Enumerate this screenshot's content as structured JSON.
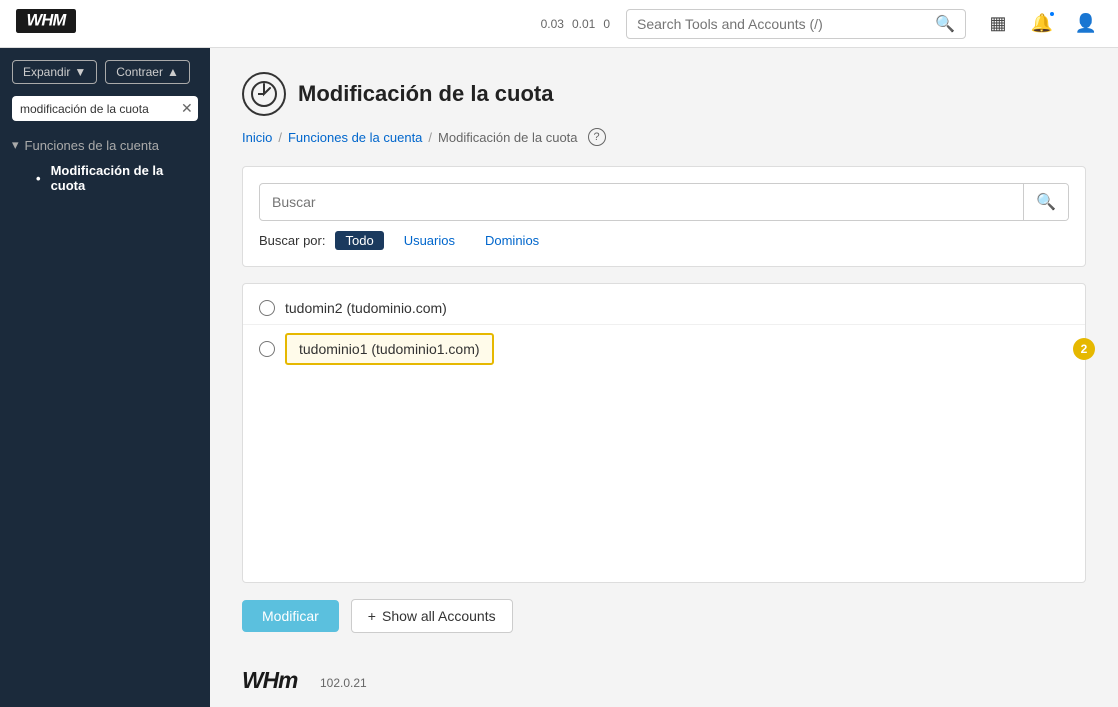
{
  "topbar": {
    "logo": "WHM",
    "metrics": [
      "0.03",
      "0.01",
      "0"
    ],
    "search_placeholder": "Search Tools and Accounts (/)"
  },
  "sidebar": {
    "expand_label": "Expandir",
    "collapse_label": "Contraer",
    "search_value": "modificación de la cuota",
    "sections": [
      {
        "name": "Funciones de la cuenta",
        "items": [
          {
            "label": "Modificación de la cuota",
            "active": true
          }
        ]
      }
    ]
  },
  "page": {
    "title": "Modificación de la cuota",
    "breadcrumb": {
      "home": "Inicio",
      "section": "Funciones de la cuenta",
      "current": "Modificación de la cuota"
    },
    "search": {
      "placeholder": "Buscar",
      "filter_label": "Buscar por:",
      "filters": [
        "Todo",
        "Usuarios",
        "Dominios"
      ],
      "active_filter": "Todo"
    },
    "accounts": [
      {
        "id": "tudomin2",
        "label": "tudomin2 (tudominio.com)",
        "selected": false
      },
      {
        "id": "tudominio1",
        "label": "tudominio1 (tudominio1.com)",
        "selected": false,
        "highlighted": true
      }
    ],
    "step_badge": "2",
    "modify_btn": "Modificar",
    "show_accounts_btn": "+ Show all Accounts"
  },
  "footer": {
    "logo": "WHm",
    "version": "102.0.21"
  }
}
